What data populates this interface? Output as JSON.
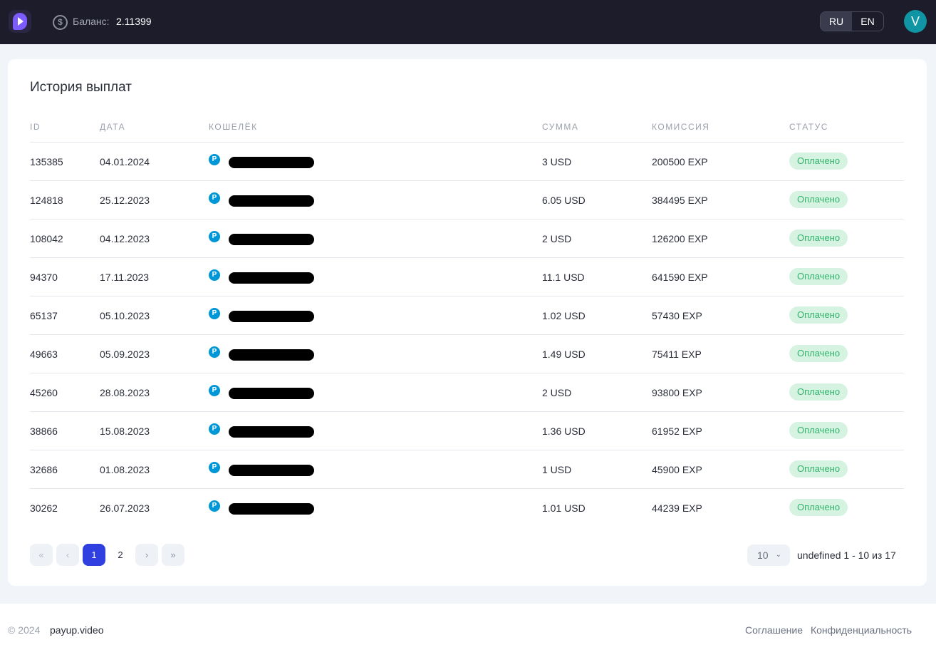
{
  "header": {
    "balance_label": "Баланс:",
    "balance_value": "2.11399",
    "balance_icon": "$",
    "languages": [
      "RU",
      "EN"
    ],
    "active_language": "RU",
    "avatar_letter": "V"
  },
  "page": {
    "title": "История выплат",
    "columns": [
      "ID",
      "ДАТА",
      "КОШЕЛЁК",
      "СУММА",
      "КОМИССИЯ",
      "СТАТУС"
    ],
    "wallet_icon_letter": "P",
    "rows": [
      {
        "id": "135385",
        "date": "04.01.2024",
        "sum": "3 USD",
        "fee": "200500 EXP",
        "status": "Оплачено"
      },
      {
        "id": "124818",
        "date": "25.12.2023",
        "sum": "6.05 USD",
        "fee": "384495 EXP",
        "status": "Оплачено"
      },
      {
        "id": "108042",
        "date": "04.12.2023",
        "sum": "2 USD",
        "fee": "126200 EXP",
        "status": "Оплачено"
      },
      {
        "id": "94370",
        "date": "17.11.2023",
        "sum": "11.1 USD",
        "fee": "641590 EXP",
        "status": "Оплачено"
      },
      {
        "id": "65137",
        "date": "05.10.2023",
        "sum": "1.02 USD",
        "fee": "57430 EXP",
        "status": "Оплачено"
      },
      {
        "id": "49663",
        "date": "05.09.2023",
        "sum": "1.49 USD",
        "fee": "75411 EXP",
        "status": "Оплачено"
      },
      {
        "id": "45260",
        "date": "28.08.2023",
        "sum": "2 USD",
        "fee": "93800 EXP",
        "status": "Оплачено"
      },
      {
        "id": "38866",
        "date": "15.08.2023",
        "sum": "1.36 USD",
        "fee": "61952 EXP",
        "status": "Оплачено"
      },
      {
        "id": "32686",
        "date": "01.08.2023",
        "sum": "1 USD",
        "fee": "45900 EXP",
        "status": "Оплачено"
      },
      {
        "id": "30262",
        "date": "26.07.2023",
        "sum": "1.01 USD",
        "fee": "44239 EXP",
        "status": "Оплачено"
      }
    ]
  },
  "pagination": {
    "first": "«",
    "prev": "‹",
    "pages": [
      "1",
      "2"
    ],
    "current_page": "1",
    "next": "›",
    "last": "»",
    "per_page": "10",
    "per_page_chevron": "⌄",
    "range_text": "undefined 1 - 10 из 17"
  },
  "footer": {
    "copyright": "© 2024",
    "site": "payup.video",
    "links": [
      "Соглашение",
      "Конфиденциальность"
    ]
  }
}
